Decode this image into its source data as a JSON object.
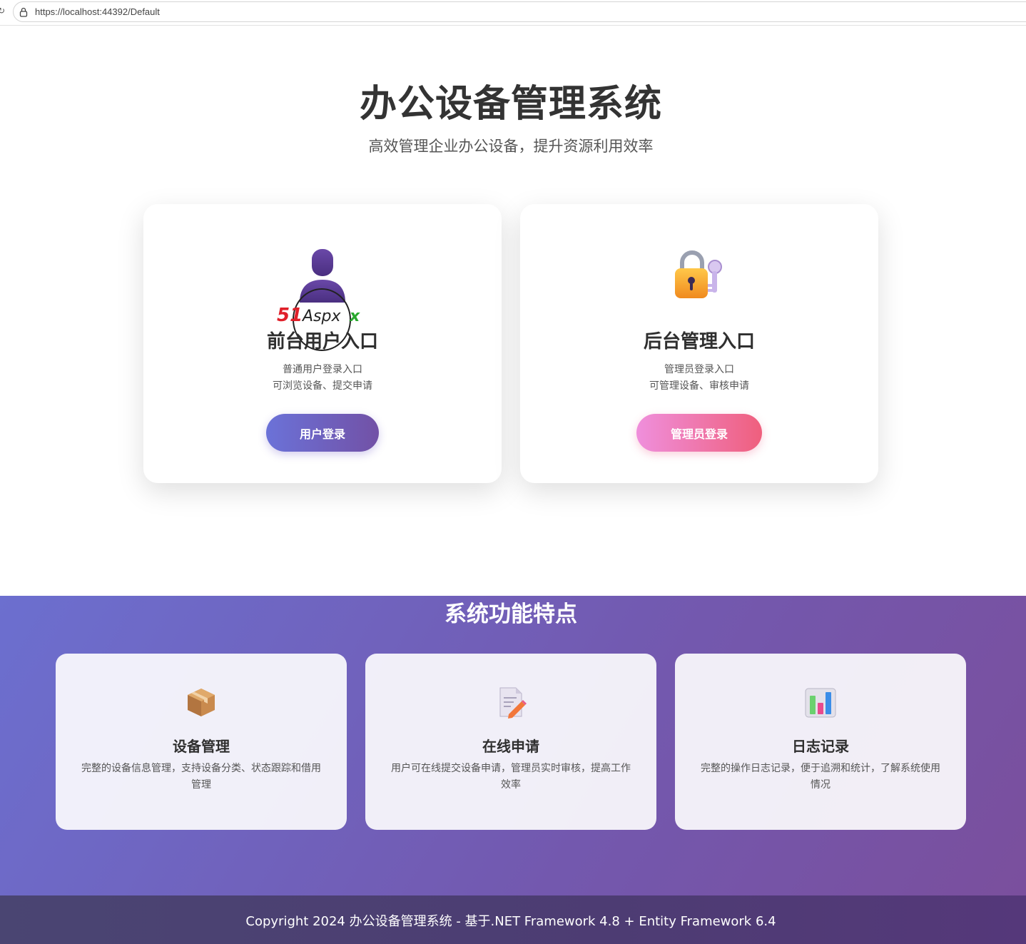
{
  "browser": {
    "url": "https://localhost:44392/Default"
  },
  "hero": {
    "title": "办公设备管理系统",
    "subtitle": "高效管理企业办公设备，提升资源利用效率"
  },
  "entries": [
    {
      "icon": "user-icon",
      "title": "前台用户入口",
      "desc_line1": "普通用户登录入口",
      "desc_line2": "可浏览设备、提交申请",
      "button_label": "用户登录"
    },
    {
      "icon": "lock-key-icon",
      "title": "后台管理入口",
      "desc_line1": "管理员登录入口",
      "desc_line2": "可管理设备、审核申请",
      "button_label": "管理员登录"
    }
  ],
  "watermark": {
    "brand": "51Aspx"
  },
  "features": {
    "title": "系统功能特点",
    "items": [
      {
        "icon": "package-icon",
        "title": "设备管理",
        "desc": "完整的设备信息管理，支持设备分类、状态跟踪和借用管理"
      },
      {
        "icon": "memo-icon",
        "title": "在线申请",
        "desc": "用户可在线提交设备申请，管理员实时审核，提高工作效率"
      },
      {
        "icon": "bar-chart-icon",
        "title": "日志记录",
        "desc": "完整的操作日志记录，便于追溯和统计，了解系统使用情况"
      }
    ]
  },
  "footer": {
    "text": "Copyright 2024 办公设备管理系统 - 基于.NET Framework 4.8 + Entity Framework 6.4"
  },
  "colors": {
    "user_button_gradient": [
      "#6b72d8",
      "#7251a6"
    ],
    "admin_button_gradient": [
      "#ef8fdc",
      "#ef5f7d"
    ],
    "features_background": [
      "#6c6fcf",
      "#7a4f9d"
    ],
    "footer_background": "#4d3c73"
  }
}
